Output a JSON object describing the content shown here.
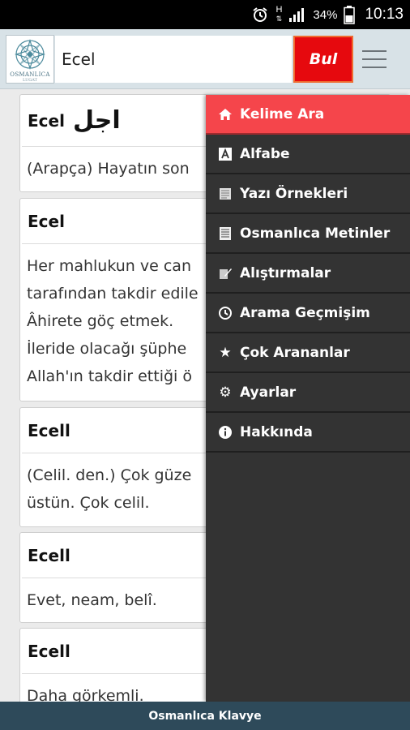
{
  "status_bar": {
    "battery": "34%",
    "time": "10:13",
    "signal_label": "H"
  },
  "header": {
    "logo_text": "OSMANLICA",
    "logo_sub": "LUGAT",
    "search_value": "Ecel",
    "search_button_label": "Bul"
  },
  "results": [
    {
      "word": "Ecel",
      "arabic": "اجل",
      "lines": [
        "(Arapça) Hayatın son"
      ]
    },
    {
      "word": "Ecel",
      "arabic": "",
      "lines": [
        "Her mahlukun ve can",
        "tarafından takdir edile",
        "Âhirete göç etmek.",
        "İleride olacağı şüphe",
        "Allah'ın takdir ettiği ö"
      ]
    },
    {
      "word": "Ecell",
      "arabic": "",
      "lines": [
        "(Celil. den.) Çok güze",
        "üstün. Çok celil."
      ]
    },
    {
      "word": "Ecell",
      "arabic": "",
      "lines": [
        "Evet, neam, belî."
      ]
    },
    {
      "word": "Ecell",
      "arabic": "",
      "lines": [
        "Daha görkemli."
      ]
    }
  ],
  "drawer": {
    "items": [
      {
        "label": "Kelime Ara",
        "icon": "home-icon",
        "active": true
      },
      {
        "label": "Alfabe",
        "icon": "alphabet-icon",
        "active": false
      },
      {
        "label": "Yazı Örnekleri",
        "icon": "document-icon",
        "active": false
      },
      {
        "label": "Osmanlıca Metinler",
        "icon": "text-document-icon",
        "active": false
      },
      {
        "label": "Alıştırmalar",
        "icon": "exercise-icon",
        "active": false
      },
      {
        "label": "Arama Geçmişim",
        "icon": "history-clock-icon",
        "active": false
      },
      {
        "label": "Çok Arananlar",
        "icon": "star-icon",
        "active": false
      },
      {
        "label": "Ayarlar",
        "icon": "gear-icon",
        "active": false
      },
      {
        "label": "Hakkında",
        "icon": "info-icon",
        "active": false
      }
    ]
  },
  "footer": {
    "label": "Osmanlıca Klavye"
  },
  "colors": {
    "accent_red": "#e6090e",
    "drawer_active": "#f5454b",
    "drawer_bg": "#333333",
    "footer_bg": "#2e4a5a",
    "header_bg": "#d8e2e7"
  }
}
